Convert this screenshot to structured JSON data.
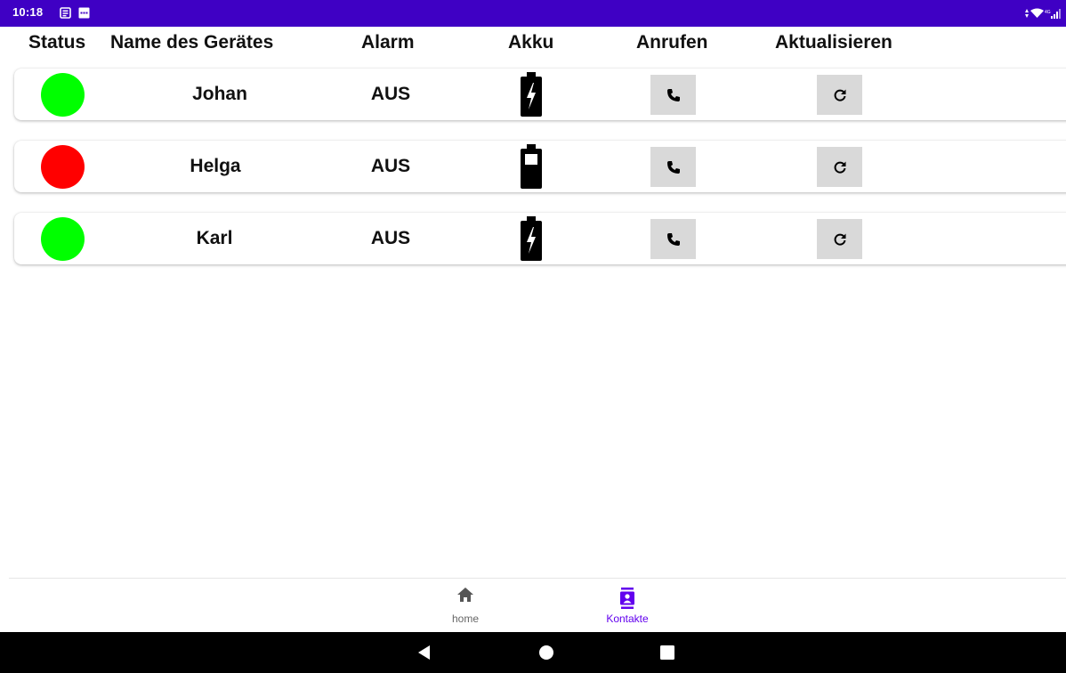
{
  "status_bar": {
    "time": "10:18",
    "icons": [
      "notification-news-icon",
      "notification-app-icon",
      "data-arrows-icon",
      "wifi-icon",
      "cell-signal-icon"
    ]
  },
  "table": {
    "headers": {
      "status": "Status",
      "name": "Name des Gerätes",
      "alarm": "Alarm",
      "akku": "Akku",
      "anrufen": "Anrufen",
      "aktualisieren": "Aktualisieren"
    },
    "rows": [
      {
        "name": "Johan",
        "alarm": "AUS",
        "status_color": "#00ff00",
        "battery": "charging"
      },
      {
        "name": "Helga",
        "alarm": "AUS",
        "status_color": "#ff0000",
        "battery": "low"
      },
      {
        "name": "Karl",
        "alarm": "AUS",
        "status_color": "#00ff00",
        "battery": "charging"
      }
    ]
  },
  "bottom_nav": {
    "items": [
      {
        "label": "home",
        "icon": "home-icon",
        "active": false
      },
      {
        "label": "Kontakte",
        "icon": "contacts-icon",
        "active": true
      }
    ]
  },
  "colors": {
    "status_bar": "#3f00c4",
    "accent": "#6200ee",
    "status_ok": "#00ff00",
    "status_alert": "#ff0000",
    "button_bg": "#d9d9d9"
  },
  "system_nav": [
    "back-icon",
    "home-circle-icon",
    "recents-icon"
  ]
}
